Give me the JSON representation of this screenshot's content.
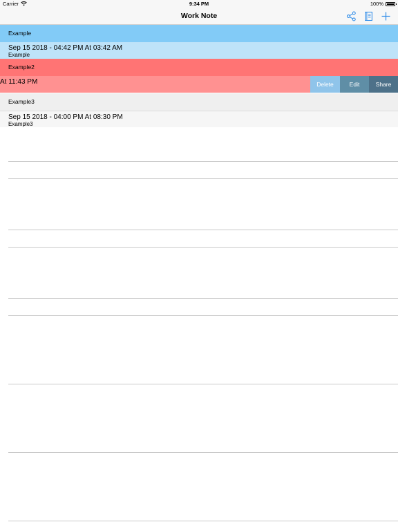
{
  "status_bar": {
    "carrier": "Carrier",
    "time": "9:34 PM",
    "battery": "100%",
    "battery_level": 1.0
  },
  "nav": {
    "title": "Work Note",
    "icons": [
      "share-icon",
      "notebook-icon",
      "plus-icon"
    ],
    "accent_color": "#2d8be8"
  },
  "entries": [
    {
      "header": "Example",
      "date_line": "Sep 15 2018  -  04:42 PM At 03:42 AM",
      "note": "Example",
      "header_color": "#82cbf7",
      "row_color": "#bee3f9"
    },
    {
      "header": "Example2",
      "date_line": "At 11:43 PM",
      "note": "",
      "header_color": "#ff7474",
      "row_color": "#ff9191"
    },
    {
      "header": "Example3",
      "date_line": "Sep 15 2018  -  04:00 PM At 08:30 PM",
      "note": "Example3",
      "header_color": "#efefef",
      "row_color": "#f6f6f6"
    }
  ],
  "swipe_actions": {
    "delete": "Delete",
    "edit": "Edit",
    "share": "Share"
  }
}
